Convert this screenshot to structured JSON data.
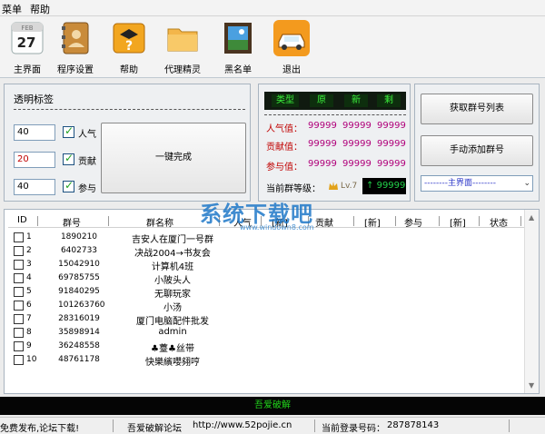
{
  "menu": {
    "items": [
      "菜单",
      "帮助"
    ]
  },
  "toolbar": {
    "buttons": [
      {
        "label": "主界面",
        "icon": "calendar-icon"
      },
      {
        "label": "程序设置",
        "icon": "contact-book-icon"
      },
      {
        "label": "帮助",
        "icon": "help-icon"
      },
      {
        "label": "代理精灵",
        "icon": "folder-icon"
      },
      {
        "label": "黑名单",
        "icon": "picture-frame-icon"
      },
      {
        "label": "退出",
        "icon": "car-icon"
      }
    ],
    "calendar": {
      "month": "FEB",
      "day": "27"
    }
  },
  "transparent_panel": {
    "title": "透明标签",
    "rows": [
      {
        "value": "40",
        "label": "人气",
        "checked": true
      },
      {
        "value": "20",
        "label": "贡献",
        "checked": true
      },
      {
        "value": "40",
        "label": "参与",
        "checked": true
      }
    ],
    "one_click_label": "一键完成"
  },
  "stats_panel": {
    "headers": [
      "类型",
      "原",
      "新",
      "剩"
    ],
    "rows": [
      {
        "label": "人气值：",
        "values": [
          "99999",
          "99999",
          "99999"
        ]
      },
      {
        "label": "贡献值：",
        "values": [
          "99999",
          "99999",
          "99999"
        ]
      },
      {
        "label": "参与值：",
        "values": [
          "99999",
          "99999",
          "99999"
        ]
      }
    ],
    "level_label": "当前群等级：",
    "level_badge": "Lv.7",
    "score": "99999"
  },
  "actions": {
    "get_list": "获取群号列表",
    "manual_add": "手动添加群号",
    "dropdown_value": "--------主界面--------"
  },
  "table": {
    "columns": [
      "ID",
      "群号",
      "群名称",
      "人气",
      "[新]",
      "贡献",
      "[新]",
      "参与",
      "[新]",
      "状态"
    ],
    "rows": [
      {
        "id": "1",
        "qq": "1890210",
        "name": "吉安人在厦门一号群"
      },
      {
        "id": "2",
        "qq": "6402733",
        "name": "决战2004→书友会"
      },
      {
        "id": "3",
        "qq": "15042910",
        "name": "计算机4班"
      },
      {
        "id": "4",
        "qq": "69785755",
        "name": "小陂头人"
      },
      {
        "id": "5",
        "qq": "91840295",
        "name": "无聊玩家"
      },
      {
        "id": "6",
        "qq": "101263760",
        "name": "小汤"
      },
      {
        "id": "7",
        "qq": "28316019",
        "name": "厦门电脑配件批发"
      },
      {
        "id": "8",
        "qq": "35898914",
        "name": "admin"
      },
      {
        "id": "9",
        "qq": "36248558",
        "name": "♣薹♣丝带"
      },
      {
        "id": "10",
        "qq": "48761178",
        "name": "快樂繽嚶翗哼"
      }
    ]
  },
  "watermark": {
    "title": "系统下载吧",
    "url": "www.windown8.com"
  },
  "footer_banner": "吾爱破解",
  "status": {
    "left": "免费发布,论坛下载!",
    "forum": "吾爱破解论坛",
    "url": "http://www.52pojie.cn",
    "login_label": "当前登录号码：",
    "login_number": "287878143"
  },
  "colors": {
    "lcd_green": "#3cf03c",
    "value_magenta": "#b0007a",
    "label_red": "#c00000",
    "banner_green": "#21d41a",
    "watermark_blue": "#1e78c8"
  }
}
